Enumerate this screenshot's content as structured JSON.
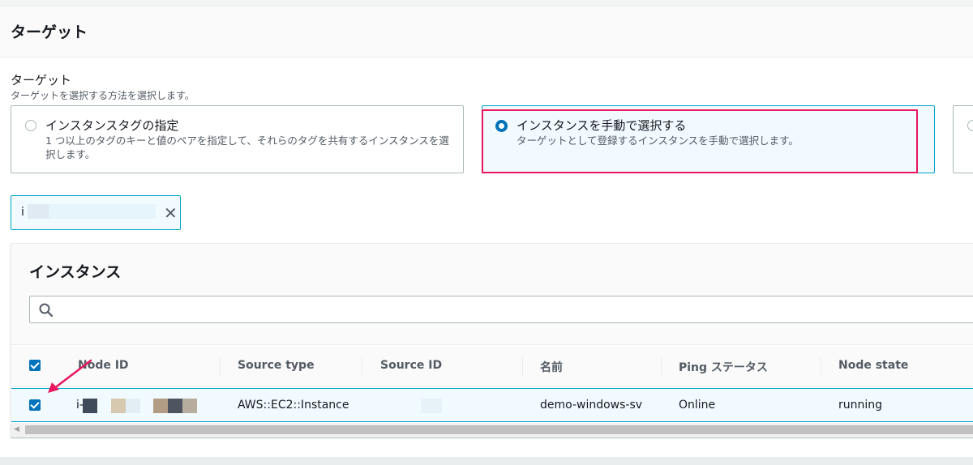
{
  "section": {
    "title": "ターゲット"
  },
  "target_field": {
    "label": "ターゲット",
    "description": "ターゲットを選択する方法を選択します。"
  },
  "tiles": [
    {
      "title": "インスタンスタグの指定",
      "description": "1 つ以上のタグのキーと値のペアを指定して、それらのタグを共有するインスタンスを選択します。",
      "selected": false
    },
    {
      "title": "インスタンスを手動で選択する",
      "description": "ターゲットとして登録するインスタンスを手動で選択します。",
      "selected": true
    }
  ],
  "token": {
    "prefix": "i"
  },
  "instances": {
    "title": "インスタンス",
    "search_placeholder": "",
    "columns": [
      "Node ID",
      "Source type",
      "Source ID",
      "名前",
      "Ping ステータス",
      "Node state"
    ],
    "rows": [
      {
        "node_id_prefix": "i-",
        "source_type": "AWS::EC2::Instance",
        "source_id": "",
        "name": "demo-windows-sv",
        "ping_status": "Online",
        "node_state": "running",
        "checked": true
      }
    ]
  },
  "colors": {
    "accent": "#0073bb",
    "highlight": "#e8175d",
    "selected_bg": "#f1faff"
  }
}
